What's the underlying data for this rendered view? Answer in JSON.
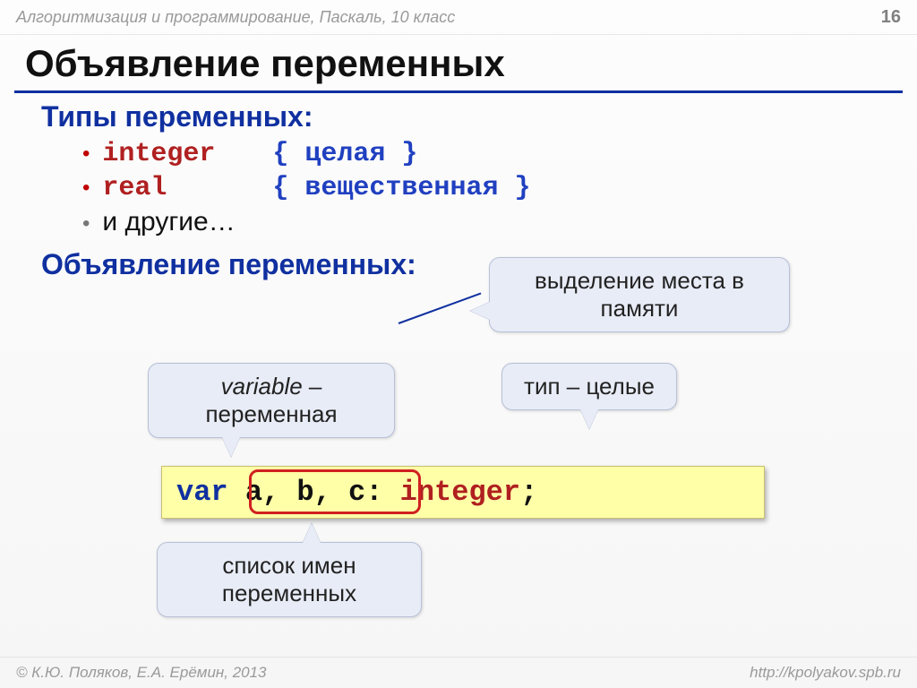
{
  "header": {
    "course": "Алгоритмизация и программирование, Паскаль, 10 класс",
    "page": "16"
  },
  "title": "Объявление переменных",
  "section_types": "Типы переменных:",
  "types": [
    {
      "keyword": "integer",
      "comment": "{ целая }"
    },
    {
      "keyword": "real",
      "comment": "{ вещественная }"
    }
  ],
  "types_etc": "и другие…",
  "section_decl": "Объявление переменных:",
  "callouts": {
    "memory": "выделение места в памяти",
    "variable_it": "variable",
    "variable_dash": " – переменная",
    "type": "тип – целые",
    "list": "список имен переменных"
  },
  "code": {
    "kw": "var",
    "ids": " a, b, c",
    "colon": ": ",
    "type": "integer",
    "semi": ";"
  },
  "footer": {
    "copyright": "© К.Ю. Поляков, Е.А. Ерёмин, 2013",
    "url": "http://kpolyakov.spb.ru"
  }
}
